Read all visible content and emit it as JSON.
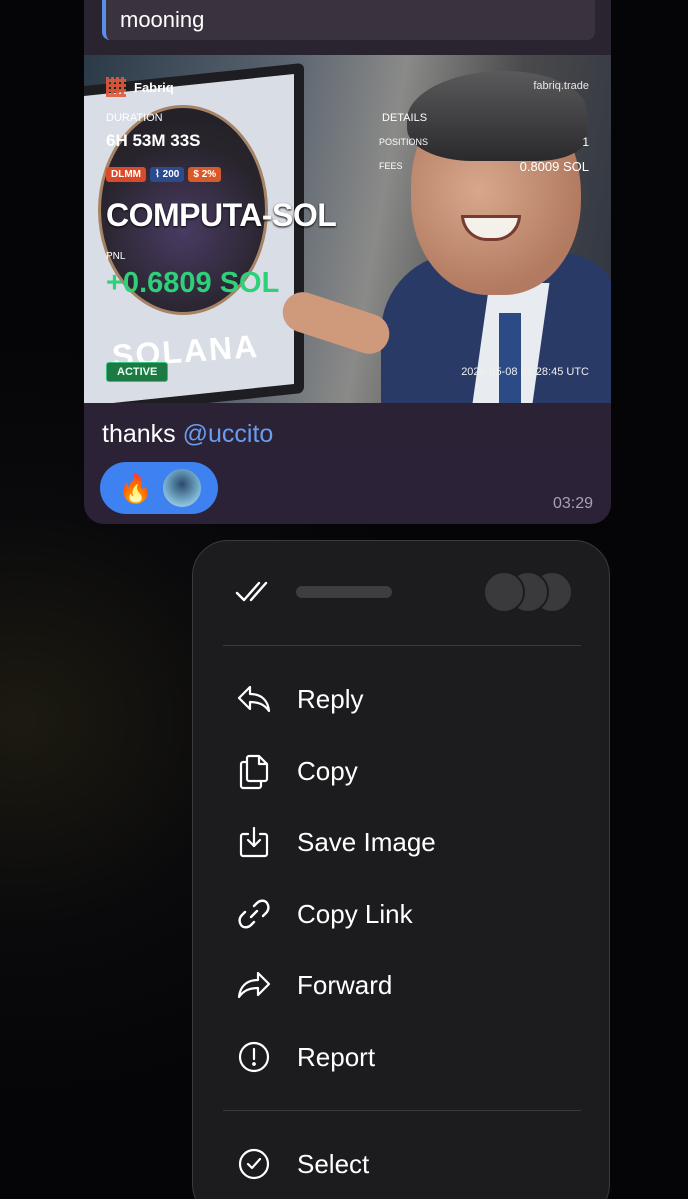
{
  "message": {
    "quote_text": "mooning",
    "card": {
      "brand": "Fabriq",
      "site": "fabriq.trade",
      "duration_label": "DURATION",
      "duration": "6H 53M 33S",
      "details_label": "DETAILS",
      "positions_label": "POSITIONS",
      "positions": "1",
      "fees_label": "FEES",
      "fees": "0.8009 SOL",
      "badges": [
        "DLMM",
        "200",
        "2%"
      ],
      "pair": "COMPUTA-SOL",
      "pnl_label": "PNL",
      "pnl": "+0.6809 SOL",
      "status": "ACTIVE",
      "background_text": "SOLANA",
      "timestamp": "2026-05-08 02:28:45 UTC"
    },
    "text_prefix": "thanks ",
    "mention": "@uccito",
    "reaction_emoji": "🔥",
    "time": "03:29"
  },
  "menu": {
    "items": [
      {
        "label": "Reply",
        "icon": "reply-icon"
      },
      {
        "label": "Copy",
        "icon": "copy-icon"
      },
      {
        "label": "Save Image",
        "icon": "save-image-icon"
      },
      {
        "label": "Copy Link",
        "icon": "link-icon"
      },
      {
        "label": "Forward",
        "icon": "forward-icon"
      },
      {
        "label": "Report",
        "icon": "report-icon"
      }
    ],
    "select_label": "Select",
    "select_icon": "select-icon"
  },
  "colors": {
    "accent": "#3d82f0",
    "mention": "#6a9cf0",
    "pnl": "#2fd07a",
    "menu_bg": "#1c1c1e"
  }
}
